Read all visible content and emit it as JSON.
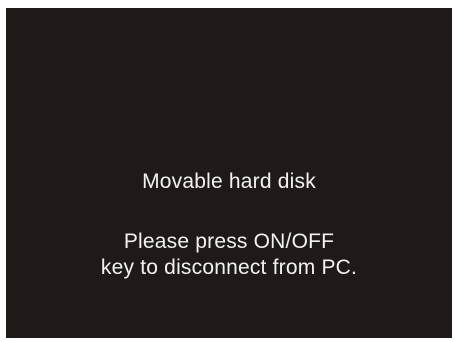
{
  "screen": {
    "background_color": "#1f1a17",
    "text_color": "#f2f2f2",
    "title": "Movable hard disk",
    "instruction_lines": [
      "Please press ON/OFF",
      "key to disconnect from PC."
    ]
  }
}
